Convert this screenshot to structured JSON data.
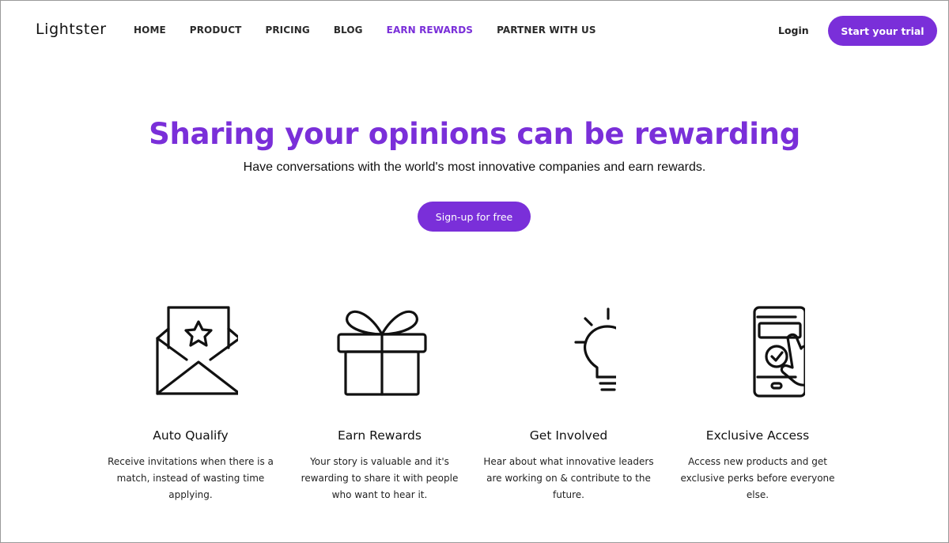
{
  "header": {
    "logo": "Lightster",
    "nav": [
      {
        "label": "HOME",
        "active": false
      },
      {
        "label": "PRODUCT",
        "active": false
      },
      {
        "label": "PRICING",
        "active": false
      },
      {
        "label": "BLOG",
        "active": false
      },
      {
        "label": "EARN REWARDS",
        "active": true
      },
      {
        "label": "PARTNER WITH US",
        "active": false
      }
    ],
    "login_label": "Login",
    "trial_label": "Start your trial"
  },
  "hero": {
    "title": "Sharing your opinions can be rewarding",
    "subtitle": "Have conversations with the world's most innovative companies and earn rewards.",
    "cta_label": "Sign-up for free"
  },
  "features": [
    {
      "icon": "envelope-star-icon",
      "title": "Auto Qualify",
      "description": "Receive invitations when there is a match, instead of wasting time applying."
    },
    {
      "icon": "gift-icon",
      "title": "Earn Rewards",
      "description": "Your story is valuable and it's rewarding to share it with people who want to hear it."
    },
    {
      "icon": "lightbulb-icon",
      "title": "Get Involved",
      "description": "Hear about what innovative leaders are working on & contribute to the future."
    },
    {
      "icon": "phone-tap-icon",
      "title": "Exclusive Access",
      "description": "Access new products and get exclusive perks before everyone else."
    }
  ],
  "colors": {
    "accent": "#7a2fd9",
    "text": "#111111",
    "background": "#ffffff"
  }
}
